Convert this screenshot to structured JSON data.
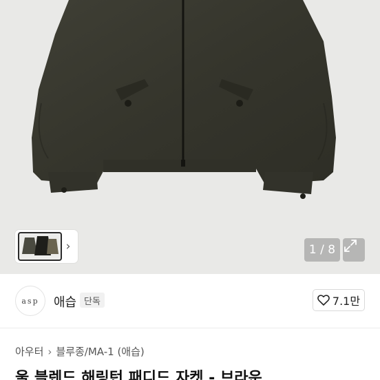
{
  "gallery": {
    "counter": "1 / 8",
    "chevron": "›"
  },
  "shop": {
    "avatar_text": "asp",
    "name": "애습",
    "badge": "단독"
  },
  "like": {
    "icon": "heart-icon",
    "count": "7.1만"
  },
  "breadcrumb": {
    "items": [
      "아우터",
      "블루종/MA-1 (애습)"
    ],
    "separator": "›"
  },
  "product": {
    "title": "울 블렌드 해링턴 패디드 자켓 - 브라운"
  },
  "colors": {
    "jacket": "#3a3a30",
    "background": "#e9e9e7"
  }
}
